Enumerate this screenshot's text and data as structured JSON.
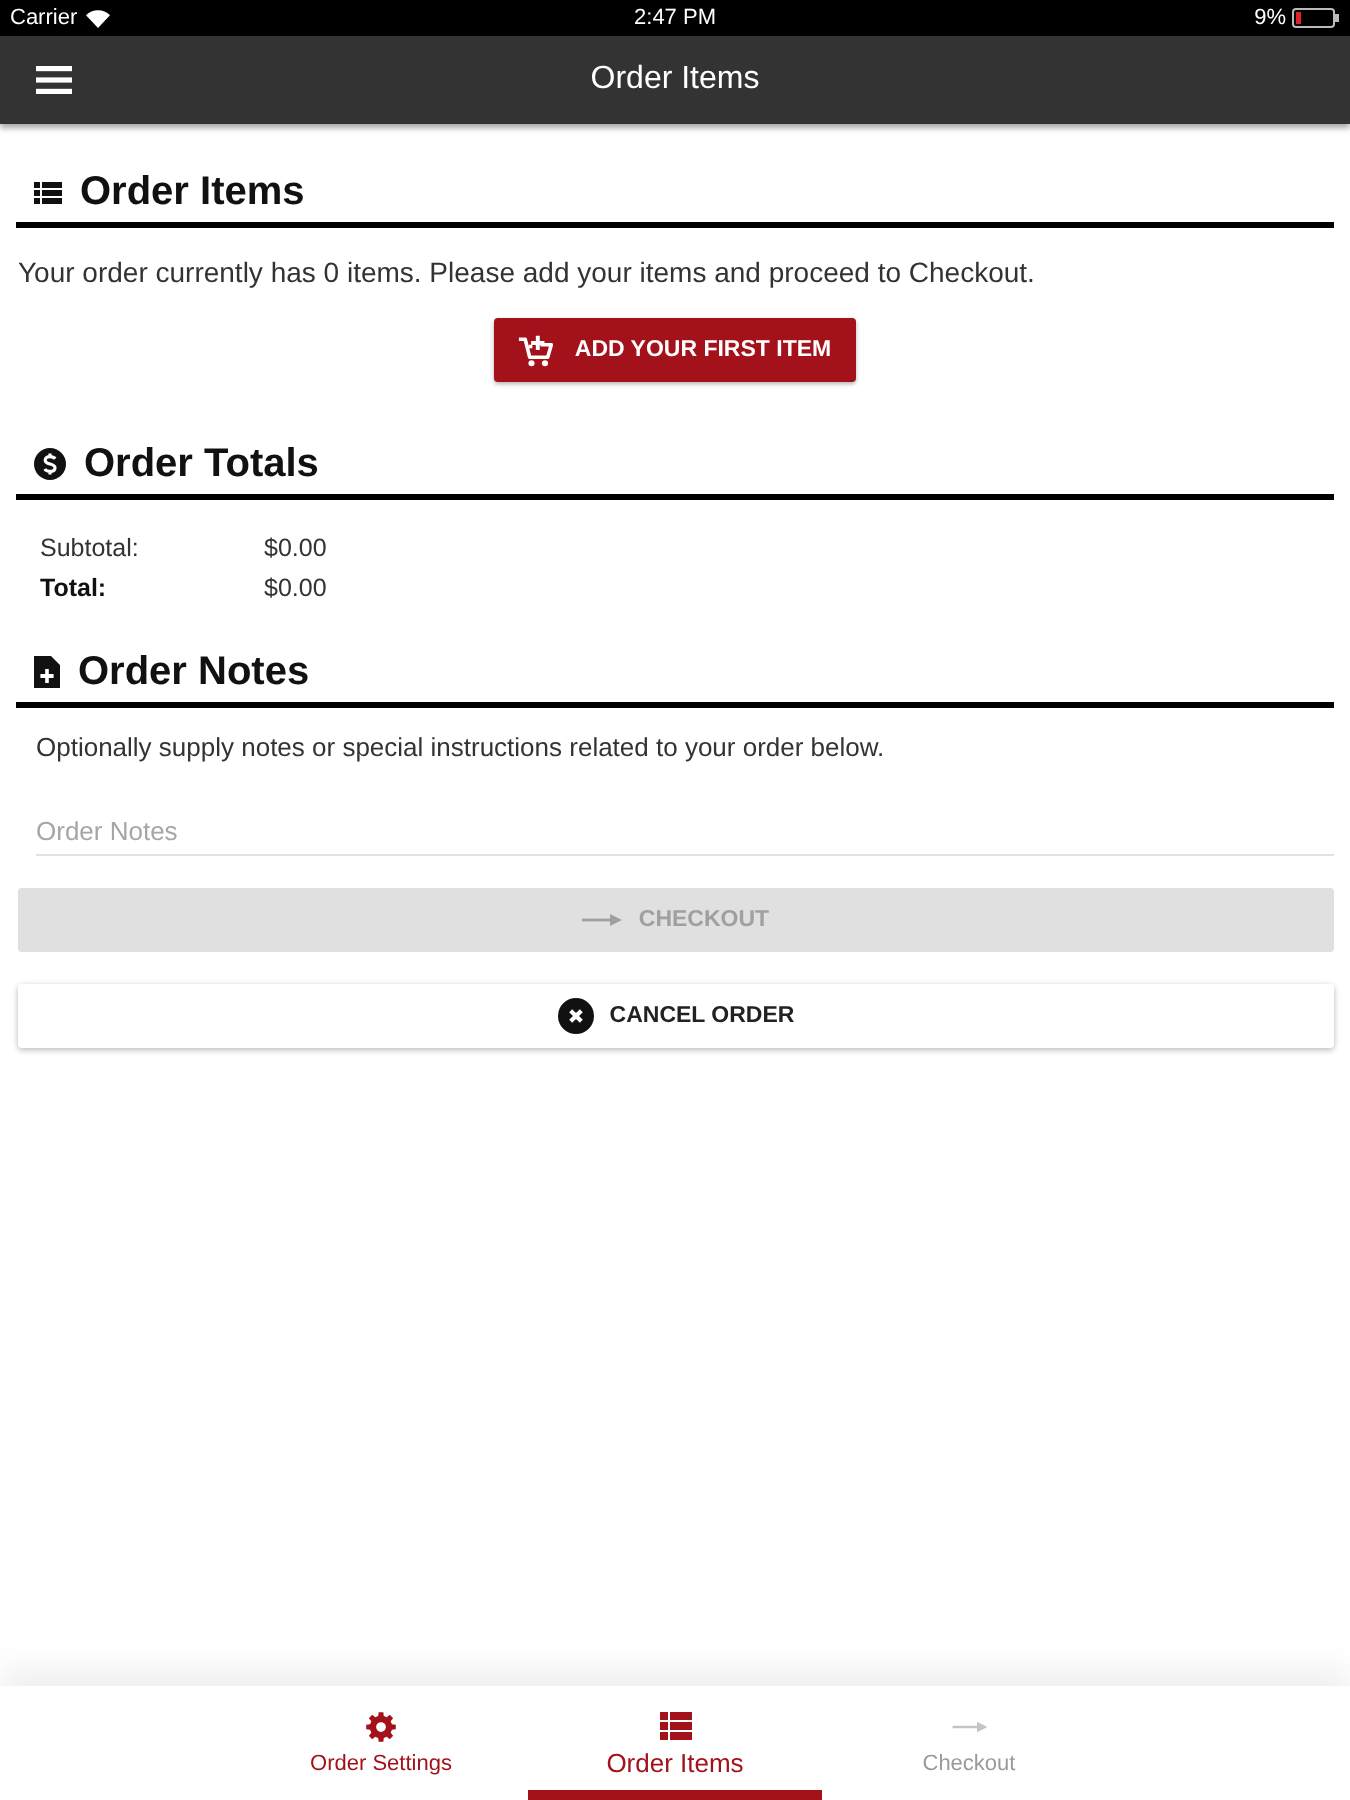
{
  "status_bar": {
    "carrier": "Carrier",
    "time": "2:47 PM",
    "battery": "9%"
  },
  "app_bar": {
    "title": "Order Items"
  },
  "sections": [
    {
      "kind": "items",
      "title": "Order Items",
      "text": "Your order currently has 0 items. Please add your items and proceed to Checkout.",
      "button": "ADD YOUR FIRST ITEM"
    },
    {
      "kind": "totals",
      "title": "Order Totals",
      "rows": [
        {
          "label": "Subtotal:",
          "value": "$0.00",
          "bold": false
        },
        {
          "label": "Total:",
          "value": "$0.00",
          "bold": true
        }
      ]
    },
    {
      "kind": "notes",
      "title": "Order Notes",
      "text": "Optionally supply notes or special instructions related to your order below.",
      "field": {
        "placeholder": "Order Notes"
      }
    }
  ],
  "actions": [
    {
      "kind": "checkout",
      "label": "CHECKOUT",
      "disabled": true
    },
    {
      "kind": "cancel",
      "label": "CANCEL ORDER",
      "disabled": false
    }
  ],
  "bottom_nav": [
    {
      "kind": "settings",
      "label": "Order Settings",
      "selected": false,
      "disabled": false
    },
    {
      "kind": "items",
      "label": "Order Items",
      "selected": true,
      "disabled": false
    },
    {
      "kind": "checkout",
      "label": "Checkout",
      "selected": false,
      "disabled": true
    }
  ]
}
